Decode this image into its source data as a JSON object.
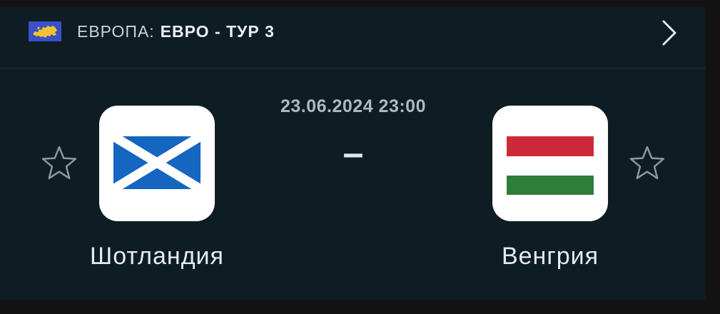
{
  "match": {
    "region": "ЕВРОПА:",
    "tournament": "ЕВРО - ТУР 3",
    "datetime": "23.06.2024 23:00",
    "score": "–",
    "home": {
      "name": "Шотландия",
      "flag_icon": "scotland-flag-icon",
      "flag_colors": {
        "field": "#1566c0",
        "cross": "#ffffff"
      }
    },
    "away": {
      "name": "Венгрия",
      "flag_icon": "hungary-flag-icon",
      "flag_colors": {
        "top": "#ce2939",
        "middle": "#ffffff",
        "bottom": "#2f7d3a"
      }
    }
  },
  "icons": {
    "region": "europe-flag-icon",
    "next": "chevron-right-icon",
    "favorite": "star-outline-icon"
  },
  "colors": {
    "background": "#0e1c24",
    "outer": "#121212",
    "europe_flag": "#3b4fc9",
    "europe_map": "#f2c230"
  }
}
